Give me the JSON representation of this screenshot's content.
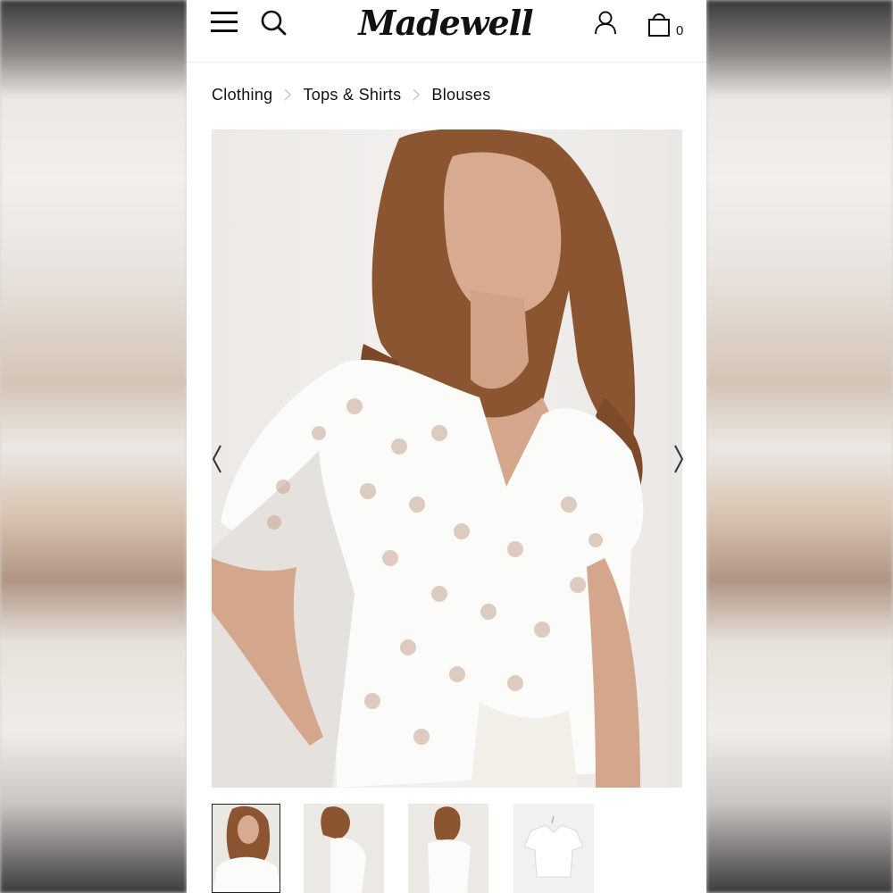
{
  "header": {
    "logo_text": "Madewell",
    "bag_count": "0",
    "icons": [
      "menu-icon",
      "search-icon",
      "account-icon",
      "shopping-bag-icon"
    ]
  },
  "breadcrumb": {
    "items": [
      "Clothing",
      "Tops & Shirts",
      "Blouses"
    ]
  },
  "gallery": {
    "thumbnail_count": 4,
    "active_thumbnail": 0
  },
  "colors": {
    "text": "#111111",
    "divider": "#ececec",
    "separator": "#c8c8c8",
    "blouse": "#fbfbfa",
    "hair": "#8a5530",
    "skin": "#d8ab90"
  }
}
